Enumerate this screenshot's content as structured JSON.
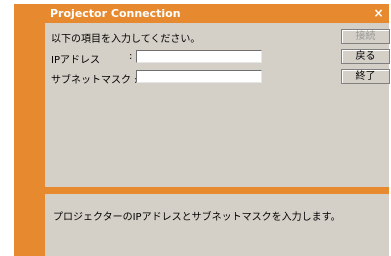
{
  "window": {
    "title": "Projector Connection",
    "close_glyph": "×",
    "accent_color": "#e78a2f",
    "background_color": "#d4d0c8"
  },
  "form": {
    "instruction": "以下の項目を入力してください。",
    "ip_label": "IPアドレス",
    "ip_colon": ":",
    "ip_value": "",
    "subnet_label": "サブネットマスク :",
    "subnet_value": ""
  },
  "buttons": {
    "connect": "接続",
    "back": "戻る",
    "exit": "終了"
  },
  "help": {
    "text": "プロジェクターのIPアドレスとサブネットマスクを入力します。"
  }
}
